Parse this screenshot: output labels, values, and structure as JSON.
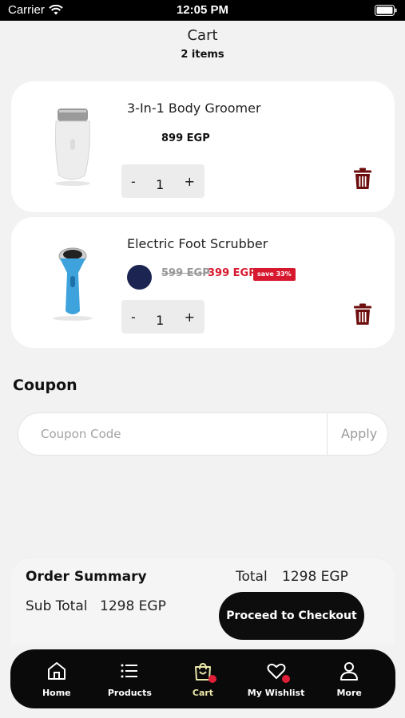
{
  "status_bar": {
    "carrier": "Carrier",
    "time": "12:05 PM"
  },
  "header": {
    "title": "Cart",
    "subtitle": "2 items"
  },
  "cart_items": [
    {
      "name": "3-In-1 Body Groomer",
      "price": "899 EGP",
      "quantity": "1",
      "minus": "-",
      "plus": "+"
    },
    {
      "name": "Electric Foot Scrubber",
      "old_price": "599 EGP",
      "price": "399 EGP",
      "save_badge": "save 33%",
      "swatch_color": "#1c2552",
      "quantity": "1",
      "minus": "-",
      "plus": "+"
    }
  ],
  "coupon": {
    "heading": "Coupon",
    "placeholder": "Coupon Code",
    "apply_label": "Apply"
  },
  "summary": {
    "heading": "Order Summary",
    "subtotal_label": "Sub Total",
    "subtotal_value": "1298 EGP",
    "total_label": "Total",
    "total_value": "1298 EGP",
    "checkout_label": "Proceed to Checkout"
  },
  "tabbar": {
    "items": [
      {
        "label": "Home",
        "icon": "home-icon"
      },
      {
        "label": "Products",
        "icon": "list-icon"
      },
      {
        "label": "Cart",
        "icon": "shopping-bag-icon",
        "active": true
      },
      {
        "label": "My Wishlist",
        "icon": "heart-icon"
      },
      {
        "label": "More",
        "icon": "user-icon"
      }
    ]
  },
  "colors": {
    "accent_red": "#d7192f",
    "trash_dark_red": "#6e0d0d",
    "active_tab": "#e9e6a8",
    "badge_dot": "#e01e37"
  }
}
